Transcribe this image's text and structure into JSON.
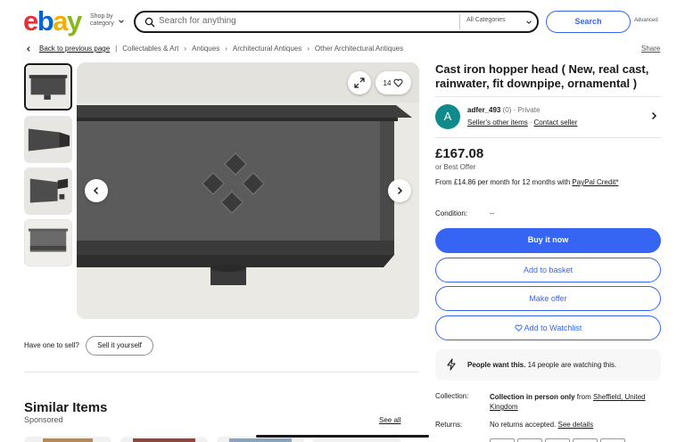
{
  "header": {
    "logo": [
      "e",
      "b",
      "a",
      "y"
    ],
    "shop_by": "Shop by category",
    "search_placeholder": "Search for anything",
    "category": "All Categories",
    "search_button": "Search",
    "advanced": "Advanced"
  },
  "breadcrumb": {
    "back": "Back to previous page",
    "items": [
      "Collectables & Art",
      "Antiques",
      "Architectural Antiques",
      "Other Architectural Antiques"
    ],
    "share": "Share"
  },
  "gallery": {
    "watch_count": "14",
    "thumbnail_count": 4
  },
  "sell": {
    "prompt": "Have one to sell?",
    "button": "Sell it yourself"
  },
  "similar": {
    "title": "Similar Items",
    "sponsored": "Sponsored",
    "see_all": "See all"
  },
  "listing": {
    "title": "Cast iron hopper head ( New, real cast, rainwater, fit downpipe, ornamental )",
    "seller_initial": "A",
    "seller_name": "adfer_493",
    "seller_feedback": "(0)",
    "seller_type": "· Private",
    "seller_other_items": "Seller's other items",
    "contact_seller": "Contact seller",
    "price": "£167.08",
    "best_offer": "or Best Offer",
    "credit_text": "From £14.86 per month for 12 months with",
    "credit_link": "PayPal Credit*",
    "condition_label": "Condition:",
    "condition_value": "--",
    "buy_now": "Buy it now",
    "add_to_basket": "Add to basket",
    "make_offer": "Make offer",
    "add_to_watchlist": "Add to Watchlist",
    "people_bold": "People want this.",
    "people_rest": "14 people are watching this.",
    "collection_label": "Collection:",
    "collection_bold": "Collection in person only",
    "collection_from": "from",
    "collection_place": "Sheffield, United Kingdom",
    "returns_label": "Returns:",
    "returns_value": "No returns accepted.",
    "see_details": "See details"
  },
  "colors": {
    "brand_blue": "#3665f3",
    "avatar": "#0f8a8a"
  }
}
